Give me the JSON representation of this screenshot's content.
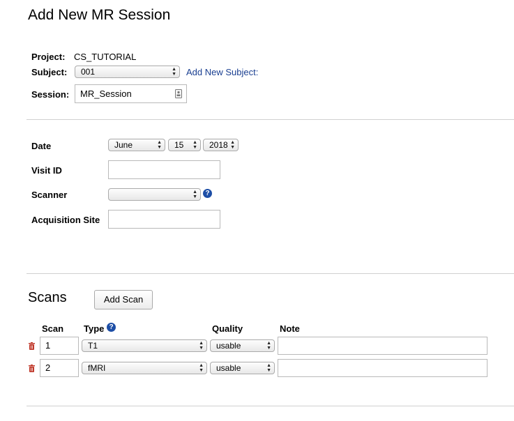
{
  "page": {
    "title": "Add New MR Session"
  },
  "project": {
    "label": "Project:",
    "value": "CS_TUTORIAL"
  },
  "subject": {
    "label": "Subject:",
    "value": "001",
    "add_link": "Add New Subject:"
  },
  "session": {
    "label": "Session:",
    "value": "MR_Session"
  },
  "date": {
    "label": "Date",
    "month": "June",
    "day": "15",
    "year": "2018"
  },
  "visit": {
    "label": "Visit ID",
    "value": ""
  },
  "scanner": {
    "label": "Scanner",
    "value": "",
    "help": "?"
  },
  "acq_site": {
    "label": "Acquisition Site",
    "value": ""
  },
  "scans": {
    "heading": "Scans",
    "add_button": "Add Scan",
    "columns": {
      "scan": "Scan",
      "type": "Type",
      "quality": "Quality",
      "note": "Note"
    },
    "type_help": "?",
    "rows": [
      {
        "scan": "1",
        "type": "T1",
        "quality": "usable",
        "note": ""
      },
      {
        "scan": "2",
        "type": "fMRI",
        "quality": "usable",
        "note": ""
      }
    ]
  },
  "colors": {
    "link": "#1a3f91",
    "help": "#1d4ea6",
    "delete": "#c0392b"
  },
  "icons": {
    "delete": "trash-icon",
    "help": "help-circle-icon",
    "field": "contact-card-icon"
  }
}
